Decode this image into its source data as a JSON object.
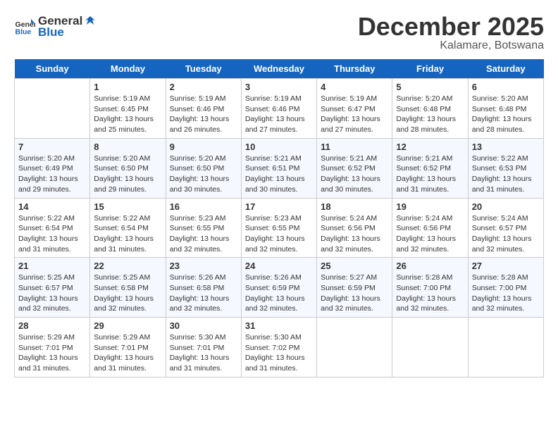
{
  "header": {
    "logo_general": "General",
    "logo_blue": "Blue",
    "title": "December 2025",
    "location": "Kalamare, Botswana"
  },
  "days_of_week": [
    "Sunday",
    "Monday",
    "Tuesday",
    "Wednesday",
    "Thursday",
    "Friday",
    "Saturday"
  ],
  "weeks": [
    {
      "cells": [
        {
          "empty": true
        },
        {
          "day": "1",
          "sunrise": "Sunrise: 5:19 AM",
          "sunset": "Sunset: 6:45 PM",
          "daylight": "Daylight: 13 hours and 25 minutes."
        },
        {
          "day": "2",
          "sunrise": "Sunrise: 5:19 AM",
          "sunset": "Sunset: 6:46 PM",
          "daylight": "Daylight: 13 hours and 26 minutes."
        },
        {
          "day": "3",
          "sunrise": "Sunrise: 5:19 AM",
          "sunset": "Sunset: 6:46 PM",
          "daylight": "Daylight: 13 hours and 27 minutes."
        },
        {
          "day": "4",
          "sunrise": "Sunrise: 5:19 AM",
          "sunset": "Sunset: 6:47 PM",
          "daylight": "Daylight: 13 hours and 27 minutes."
        },
        {
          "day": "5",
          "sunrise": "Sunrise: 5:20 AM",
          "sunset": "Sunset: 6:48 PM",
          "daylight": "Daylight: 13 hours and 28 minutes."
        },
        {
          "day": "6",
          "sunrise": "Sunrise: 5:20 AM",
          "sunset": "Sunset: 6:48 PM",
          "daylight": "Daylight: 13 hours and 28 minutes."
        }
      ]
    },
    {
      "cells": [
        {
          "day": "7",
          "sunrise": "Sunrise: 5:20 AM",
          "sunset": "Sunset: 6:49 PM",
          "daylight": "Daylight: 13 hours and 29 minutes."
        },
        {
          "day": "8",
          "sunrise": "Sunrise: 5:20 AM",
          "sunset": "Sunset: 6:50 PM",
          "daylight": "Daylight: 13 hours and 29 minutes."
        },
        {
          "day": "9",
          "sunrise": "Sunrise: 5:20 AM",
          "sunset": "Sunset: 6:50 PM",
          "daylight": "Daylight: 13 hours and 30 minutes."
        },
        {
          "day": "10",
          "sunrise": "Sunrise: 5:21 AM",
          "sunset": "Sunset: 6:51 PM",
          "daylight": "Daylight: 13 hours and 30 minutes."
        },
        {
          "day": "11",
          "sunrise": "Sunrise: 5:21 AM",
          "sunset": "Sunset: 6:52 PM",
          "daylight": "Daylight: 13 hours and 30 minutes."
        },
        {
          "day": "12",
          "sunrise": "Sunrise: 5:21 AM",
          "sunset": "Sunset: 6:52 PM",
          "daylight": "Daylight: 13 hours and 31 minutes."
        },
        {
          "day": "13",
          "sunrise": "Sunrise: 5:22 AM",
          "sunset": "Sunset: 6:53 PM",
          "daylight": "Daylight: 13 hours and 31 minutes."
        }
      ]
    },
    {
      "cells": [
        {
          "day": "14",
          "sunrise": "Sunrise: 5:22 AM",
          "sunset": "Sunset: 6:54 PM",
          "daylight": "Daylight: 13 hours and 31 minutes."
        },
        {
          "day": "15",
          "sunrise": "Sunrise: 5:22 AM",
          "sunset": "Sunset: 6:54 PM",
          "daylight": "Daylight: 13 hours and 31 minutes."
        },
        {
          "day": "16",
          "sunrise": "Sunrise: 5:23 AM",
          "sunset": "Sunset: 6:55 PM",
          "daylight": "Daylight: 13 hours and 32 minutes."
        },
        {
          "day": "17",
          "sunrise": "Sunrise: 5:23 AM",
          "sunset": "Sunset: 6:55 PM",
          "daylight": "Daylight: 13 hours and 32 minutes."
        },
        {
          "day": "18",
          "sunrise": "Sunrise: 5:24 AM",
          "sunset": "Sunset: 6:56 PM",
          "daylight": "Daylight: 13 hours and 32 minutes."
        },
        {
          "day": "19",
          "sunrise": "Sunrise: 5:24 AM",
          "sunset": "Sunset: 6:56 PM",
          "daylight": "Daylight: 13 hours and 32 minutes."
        },
        {
          "day": "20",
          "sunrise": "Sunrise: 5:24 AM",
          "sunset": "Sunset: 6:57 PM",
          "daylight": "Daylight: 13 hours and 32 minutes."
        }
      ]
    },
    {
      "cells": [
        {
          "day": "21",
          "sunrise": "Sunrise: 5:25 AM",
          "sunset": "Sunset: 6:57 PM",
          "daylight": "Daylight: 13 hours and 32 minutes."
        },
        {
          "day": "22",
          "sunrise": "Sunrise: 5:25 AM",
          "sunset": "Sunset: 6:58 PM",
          "daylight": "Daylight: 13 hours and 32 minutes."
        },
        {
          "day": "23",
          "sunrise": "Sunrise: 5:26 AM",
          "sunset": "Sunset: 6:58 PM",
          "daylight": "Daylight: 13 hours and 32 minutes."
        },
        {
          "day": "24",
          "sunrise": "Sunrise: 5:26 AM",
          "sunset": "Sunset: 6:59 PM",
          "daylight": "Daylight: 13 hours and 32 minutes."
        },
        {
          "day": "25",
          "sunrise": "Sunrise: 5:27 AM",
          "sunset": "Sunset: 6:59 PM",
          "daylight": "Daylight: 13 hours and 32 minutes."
        },
        {
          "day": "26",
          "sunrise": "Sunrise: 5:28 AM",
          "sunset": "Sunset: 7:00 PM",
          "daylight": "Daylight: 13 hours and 32 minutes."
        },
        {
          "day": "27",
          "sunrise": "Sunrise: 5:28 AM",
          "sunset": "Sunset: 7:00 PM",
          "daylight": "Daylight: 13 hours and 32 minutes."
        }
      ]
    },
    {
      "cells": [
        {
          "day": "28",
          "sunrise": "Sunrise: 5:29 AM",
          "sunset": "Sunset: 7:01 PM",
          "daylight": "Daylight: 13 hours and 31 minutes."
        },
        {
          "day": "29",
          "sunrise": "Sunrise: 5:29 AM",
          "sunset": "Sunset: 7:01 PM",
          "daylight": "Daylight: 13 hours and 31 minutes."
        },
        {
          "day": "30",
          "sunrise": "Sunrise: 5:30 AM",
          "sunset": "Sunset: 7:01 PM",
          "daylight": "Daylight: 13 hours and 31 minutes."
        },
        {
          "day": "31",
          "sunrise": "Sunrise: 5:30 AM",
          "sunset": "Sunset: 7:02 PM",
          "daylight": "Daylight: 13 hours and 31 minutes."
        },
        {
          "empty": true
        },
        {
          "empty": true
        },
        {
          "empty": true
        }
      ]
    }
  ]
}
